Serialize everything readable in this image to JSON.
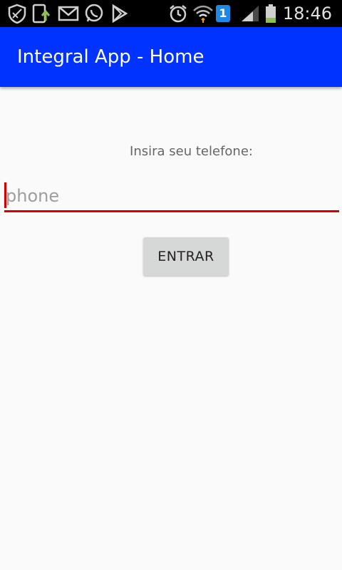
{
  "status_bar": {
    "time": "18:46",
    "icons": [
      "shield-icon",
      "download-icon",
      "gmail-icon",
      "whatsapp-icon",
      "play-store-icon",
      "alarm-icon",
      "wifi-icon",
      "sim-1-icon",
      "signal-icon",
      "battery-icon"
    ],
    "sim_number": "1"
  },
  "app_bar": {
    "title": "Integral App - Home",
    "color": "#0033ff"
  },
  "form": {
    "label": "Insira seu telefone:",
    "phone_placeholder": "phone",
    "phone_value": "",
    "submit_label": "ENTRAR"
  },
  "colors": {
    "accent": "#d50000",
    "button_bg": "#d6d7d7",
    "background": "#fafafa"
  }
}
